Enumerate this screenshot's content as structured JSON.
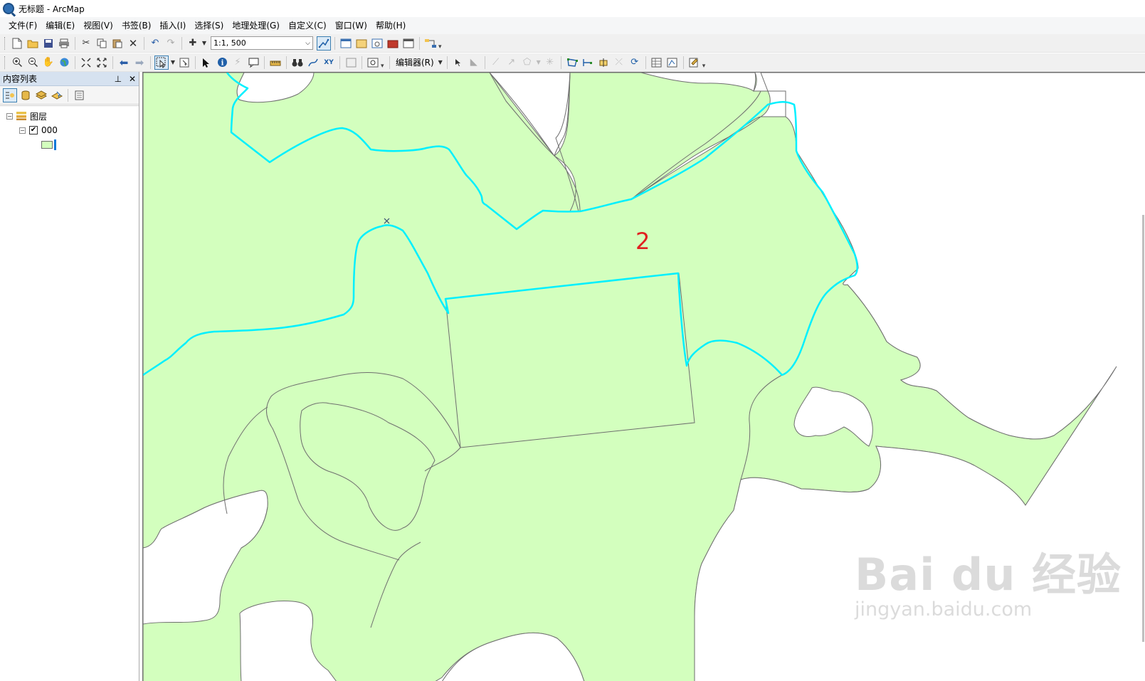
{
  "window": {
    "title": "无标题 - ArcMap"
  },
  "menu": [
    "文件(F)",
    "编辑(E)",
    "视图(V)",
    "书签(B)",
    "插入(I)",
    "选择(S)",
    "地理处理(G)",
    "自定义(C)",
    "窗口(W)",
    "帮助(H)"
  ],
  "toolbar": {
    "scale_value": "1:1, 500",
    "editor_label": "编辑器(R)"
  },
  "toc": {
    "title": "内容列表",
    "root_label": "图层",
    "layer_label": "000",
    "layer_checked": true
  },
  "map": {
    "annotation": "2"
  },
  "watermark": {
    "main": "Bai du 经验",
    "sub": "jingyan.baidu.com"
  },
  "colors": {
    "polygon_fill": "#d3ffbe",
    "polygon_outline": "#6e6e6e",
    "selection": "#00ffff",
    "annotation": "#e02020"
  }
}
